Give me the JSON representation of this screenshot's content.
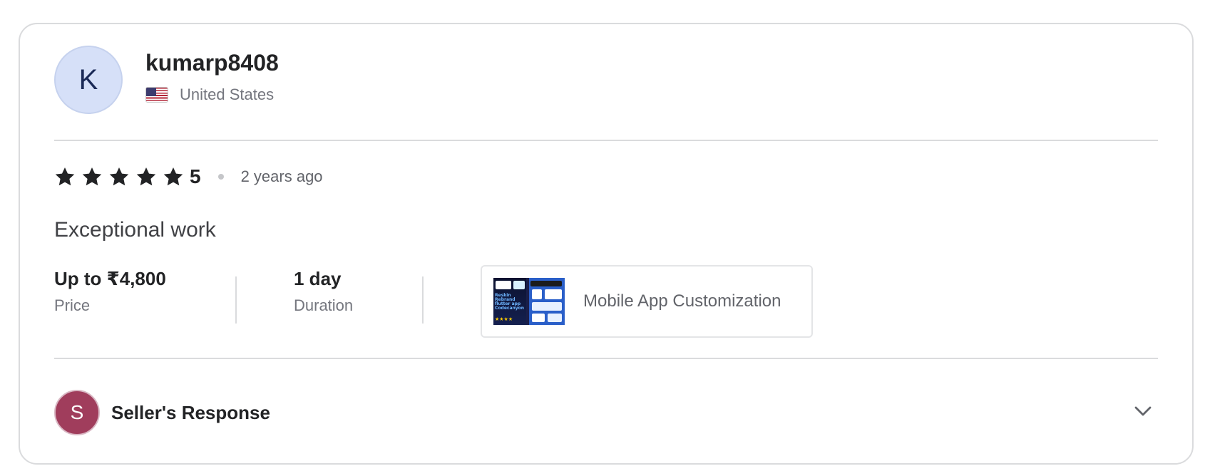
{
  "review": {
    "user": {
      "avatar_letter": "K",
      "username": "kumarp8408",
      "country": "United States",
      "flag_icon": "us-flag-icon"
    },
    "rating": {
      "stars": 5,
      "value": "5",
      "time_ago": "2 years ago"
    },
    "text": "Exceptional work",
    "price": {
      "value": "Up to ₹4,800",
      "label": "Price"
    },
    "duration": {
      "value": "1 day",
      "label": "Duration"
    },
    "gig": {
      "title": "Mobile App Customization"
    }
  },
  "seller_response": {
    "avatar_letter": "S",
    "label": "Seller's Response",
    "expand_icon": "chevron-down-icon"
  },
  "colors": {
    "star": "#222325",
    "seller_avatar": "#a03d5c",
    "user_avatar": "#d6e0f8"
  }
}
